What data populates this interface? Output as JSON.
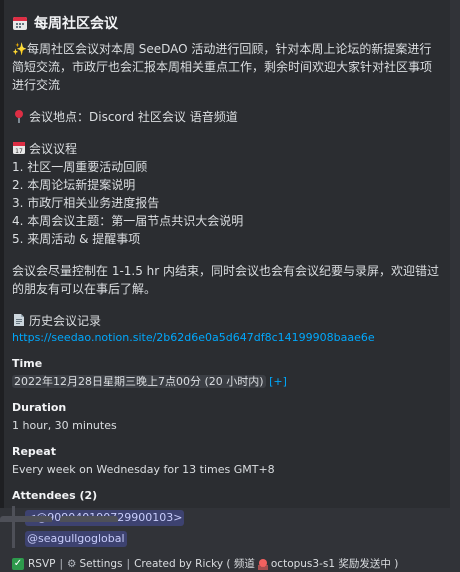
{
  "embed": {
    "title": "每周社区会议",
    "intro": "✨每周社区会议对本周 SeeDAO 活动进行回顾，针对本周上论坛的新提案进行简短交流，市政厅也会汇报本周相关重点工作，剩余时间欢迎大家针对社区事项进行交流",
    "location": "会议地点：Discord 社区会议 语音频道",
    "agenda_title": "会议议程",
    "agenda": [
      "1. 社区一周重要活动回顾",
      "2. 本周论坛新提案说明",
      "3. 市政厅相关业务进度报告",
      "4. 本周会议主题：第一届节点共识大会说明",
      "5. 来周活动 & 提醒事项"
    ],
    "note": "会议会尽量控制在 1-1.5 hr 内结束，同时会议也会有会议纪要与录屏，欢迎错过的朋友有可以在事后了解。",
    "history_title": "历史会议记录",
    "history_link": "https://seedao.notion.site/2b62d6e0a5d647df8c14199908baae6e"
  },
  "fields": {
    "time_name": "Time",
    "time_value": "2022年12月28日星期三晚上7点00分",
    "time_relative": "(20 小时内)",
    "time_plus": "[+]",
    "duration_name": "Duration",
    "duration_value": "1 hour, 30 minutes",
    "repeat_name": "Repeat",
    "repeat_value": "Every week on Wednesday for 13 times GMT+8",
    "attendees_name": "Attendees (2)",
    "attendees": [
      "<@909040190729900103>",
      "@seagullgoglobal"
    ]
  },
  "footer": {
    "rsvp": "RSVP",
    "settings": "Settings",
    "created_by": "Created by Ricky ( 频道",
    "channel": "octopus3-s1 奖励发送中 )"
  },
  "colors": {
    "background": "#313338",
    "embed_bg": "#2b2d31",
    "link": "#00a8fc",
    "mention_bg": "#3d4270",
    "rsvp_green": "#2d9a4c"
  }
}
